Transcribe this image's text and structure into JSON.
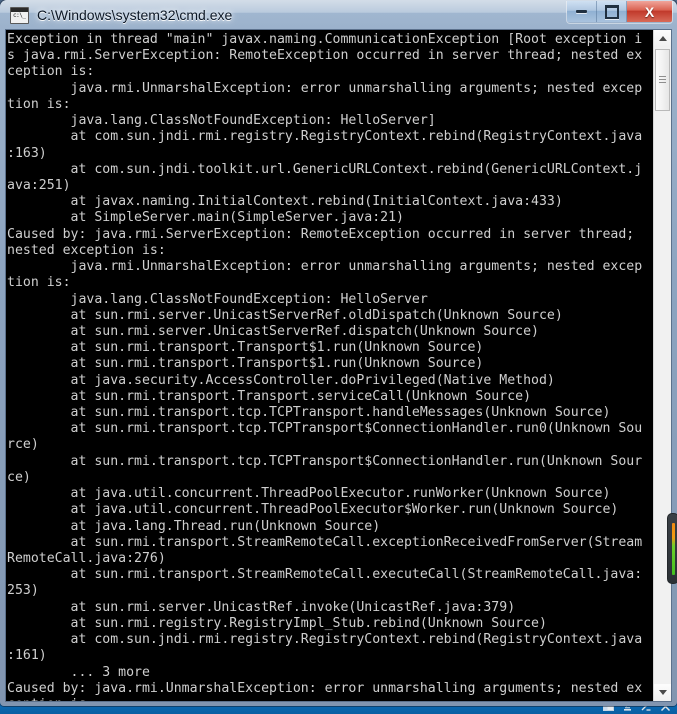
{
  "window": {
    "title": "C:\\Windows\\system32\\cmd.exe",
    "icon": "cmd-icon",
    "controls": {
      "minimize_label": "–",
      "maximize_label": "□",
      "close_label": "X"
    },
    "colors": {
      "console_bg": "#000000",
      "console_fg": "#cfcfcf",
      "frame": "#8da4c0",
      "close_button": "#c0382a",
      "taskbar": "#0a67b0"
    }
  },
  "console": {
    "lines": [
      "Exception in thread \"main\" javax.naming.CommunicationException [Root exception i",
      "s java.rmi.ServerException: RemoteException occurred in server thread; nested ex",
      "ception is:",
      "        java.rmi.UnmarshalException: error unmarshalling arguments; nested excep",
      "tion is:",
      "        java.lang.ClassNotFoundException: HelloServer]",
      "        at com.sun.jndi.rmi.registry.RegistryContext.rebind(RegistryContext.java",
      ":163)",
      "        at com.sun.jndi.toolkit.url.GenericURLContext.rebind(GenericURLContext.j",
      "ava:251)",
      "        at javax.naming.InitialContext.rebind(InitialContext.java:433)",
      "        at SimpleServer.main(SimpleServer.java:21)",
      "Caused by: java.rmi.ServerException: RemoteException occurred in server thread;",
      "nested exception is:",
      "        java.rmi.UnmarshalException: error unmarshalling arguments; nested excep",
      "tion is:",
      "        java.lang.ClassNotFoundException: HelloServer",
      "        at sun.rmi.server.UnicastServerRef.oldDispatch(Unknown Source)",
      "        at sun.rmi.server.UnicastServerRef.dispatch(Unknown Source)",
      "        at sun.rmi.transport.Transport$1.run(Unknown Source)",
      "        at sun.rmi.transport.Transport$1.run(Unknown Source)",
      "        at java.security.AccessController.doPrivileged(Native Method)",
      "        at sun.rmi.transport.Transport.serviceCall(Unknown Source)",
      "        at sun.rmi.transport.tcp.TCPTransport.handleMessages(Unknown Source)",
      "        at sun.rmi.transport.tcp.TCPTransport$ConnectionHandler.run0(Unknown Sou",
      "rce)",
      "        at sun.rmi.transport.tcp.TCPTransport$ConnectionHandler.run(Unknown Sour",
      "ce)",
      "        at java.util.concurrent.ThreadPoolExecutor.runWorker(Unknown Source)",
      "        at java.util.concurrent.ThreadPoolExecutor$Worker.run(Unknown Source)",
      "        at java.lang.Thread.run(Unknown Source)",
      "        at sun.rmi.transport.StreamRemoteCall.exceptionReceivedFromServer(Stream",
      "RemoteCall.java:276)",
      "        at sun.rmi.transport.StreamRemoteCall.executeCall(StreamRemoteCall.java:",
      "253)",
      "        at sun.rmi.server.UnicastRef.invoke(UnicastRef.java:379)",
      "        at sun.rmi.registry.RegistryImpl_Stub.rebind(Unknown Source)",
      "        at com.sun.jndi.rmi.registry.RegistryContext.rebind(RegistryContext.java",
      ":161)",
      "        ... 3 more",
      "Caused by: java.rmi.UnmarshalException: error unmarshalling arguments; nested ex",
      "ception is:"
    ]
  },
  "scrollbar": {
    "up_arrow": "scroll-up-arrow",
    "down_arrow": "scroll-down-arrow",
    "thumb": "scroll-thumb"
  },
  "taskbar": {
    "icons": [
      "explorer-icon",
      "java-icon",
      "console-icon",
      "app-icon"
    ]
  }
}
